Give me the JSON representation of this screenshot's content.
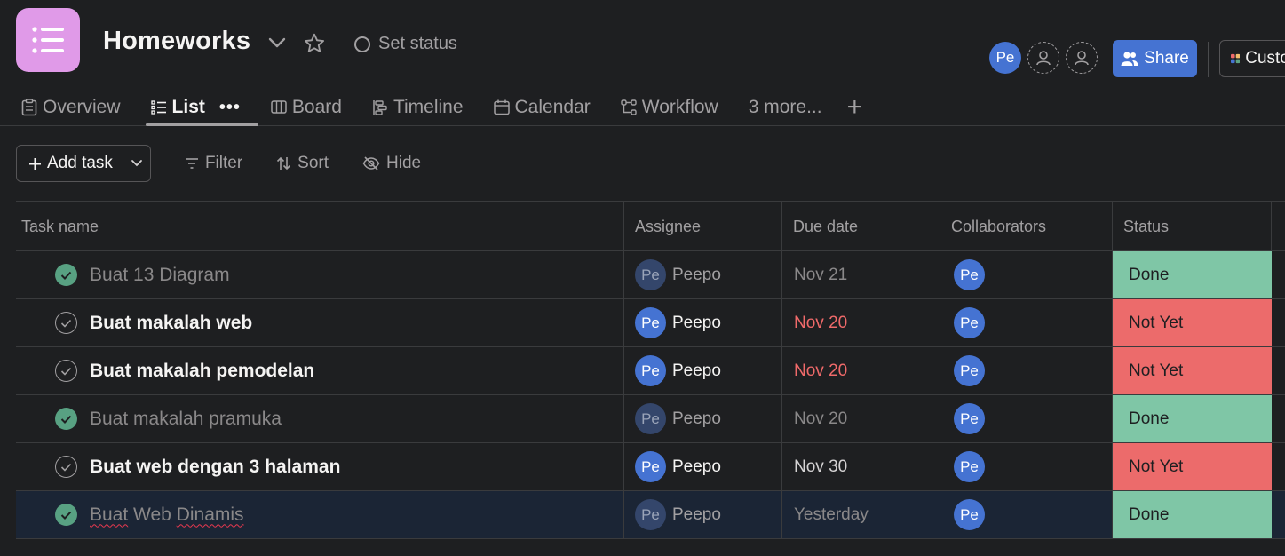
{
  "project": {
    "title": "Homeworks",
    "set_status": "Set status"
  },
  "header": {
    "avatar_initials": "Pe",
    "share_label": "Share",
    "customize_label": "Customize"
  },
  "tabs": [
    {
      "label": "Overview",
      "icon": "overview-icon"
    },
    {
      "label": "List",
      "icon": "list-icon",
      "active": true
    },
    {
      "label": "Board",
      "icon": "board-icon"
    },
    {
      "label": "Timeline",
      "icon": "timeline-icon"
    },
    {
      "label": "Calendar",
      "icon": "calendar-icon"
    },
    {
      "label": "Workflow",
      "icon": "workflow-icon"
    },
    {
      "label": "3 more..."
    }
  ],
  "toolbar": {
    "add_task_label": "Add task",
    "filter_label": "Filter",
    "sort_label": "Sort",
    "hide_label": "Hide"
  },
  "table": {
    "columns": [
      "Task name",
      "Assignee",
      "Due date",
      "Collaborators",
      "Status"
    ],
    "rows": [
      {
        "name": "Buat 13 Diagram",
        "completed": true,
        "assignee": "Peepo",
        "assignee_initials": "Pe",
        "due": "Nov 21",
        "collaborator_initials": "Pe",
        "status": "Done"
      },
      {
        "name": "Buat makalah web",
        "completed": false,
        "assignee": "Peepo",
        "assignee_initials": "Pe",
        "due": "Nov 20",
        "collaborator_initials": "Pe",
        "status": "Not Yet"
      },
      {
        "name": "Buat makalah pemodelan",
        "completed": false,
        "assignee": "Peepo",
        "assignee_initials": "Pe",
        "due": "Nov 20",
        "collaborator_initials": "Pe",
        "status": "Not Yet"
      },
      {
        "name": "Buat makalah pramuka",
        "completed": true,
        "assignee": "Peepo",
        "assignee_initials": "Pe",
        "due": "Nov 20",
        "collaborator_initials": "Pe",
        "status": "Done"
      },
      {
        "name": "Buat web dengan 3 halaman",
        "completed": false,
        "assignee": "Peepo",
        "assignee_initials": "Pe",
        "due": "Nov 30",
        "collaborator_initials": "Pe",
        "status": "Not Yet"
      },
      {
        "name_parts": [
          "Buat",
          "Web",
          "Dinamis"
        ],
        "name": "Buat Web Dinamis",
        "completed": true,
        "assignee": "Peepo",
        "assignee_initials": "Pe",
        "due": "Yesterday",
        "collaborator_initials": "Pe",
        "status": "Done"
      }
    ]
  },
  "colors": {
    "background": "#1e1f21",
    "accent": "#4573d2",
    "project_icon": "#e09ae8",
    "status_done": "#7fc6a6",
    "status_not_yet": "#ec6b6b",
    "due_overdue": "#f06a6a",
    "selected_row": "#1b2535"
  }
}
